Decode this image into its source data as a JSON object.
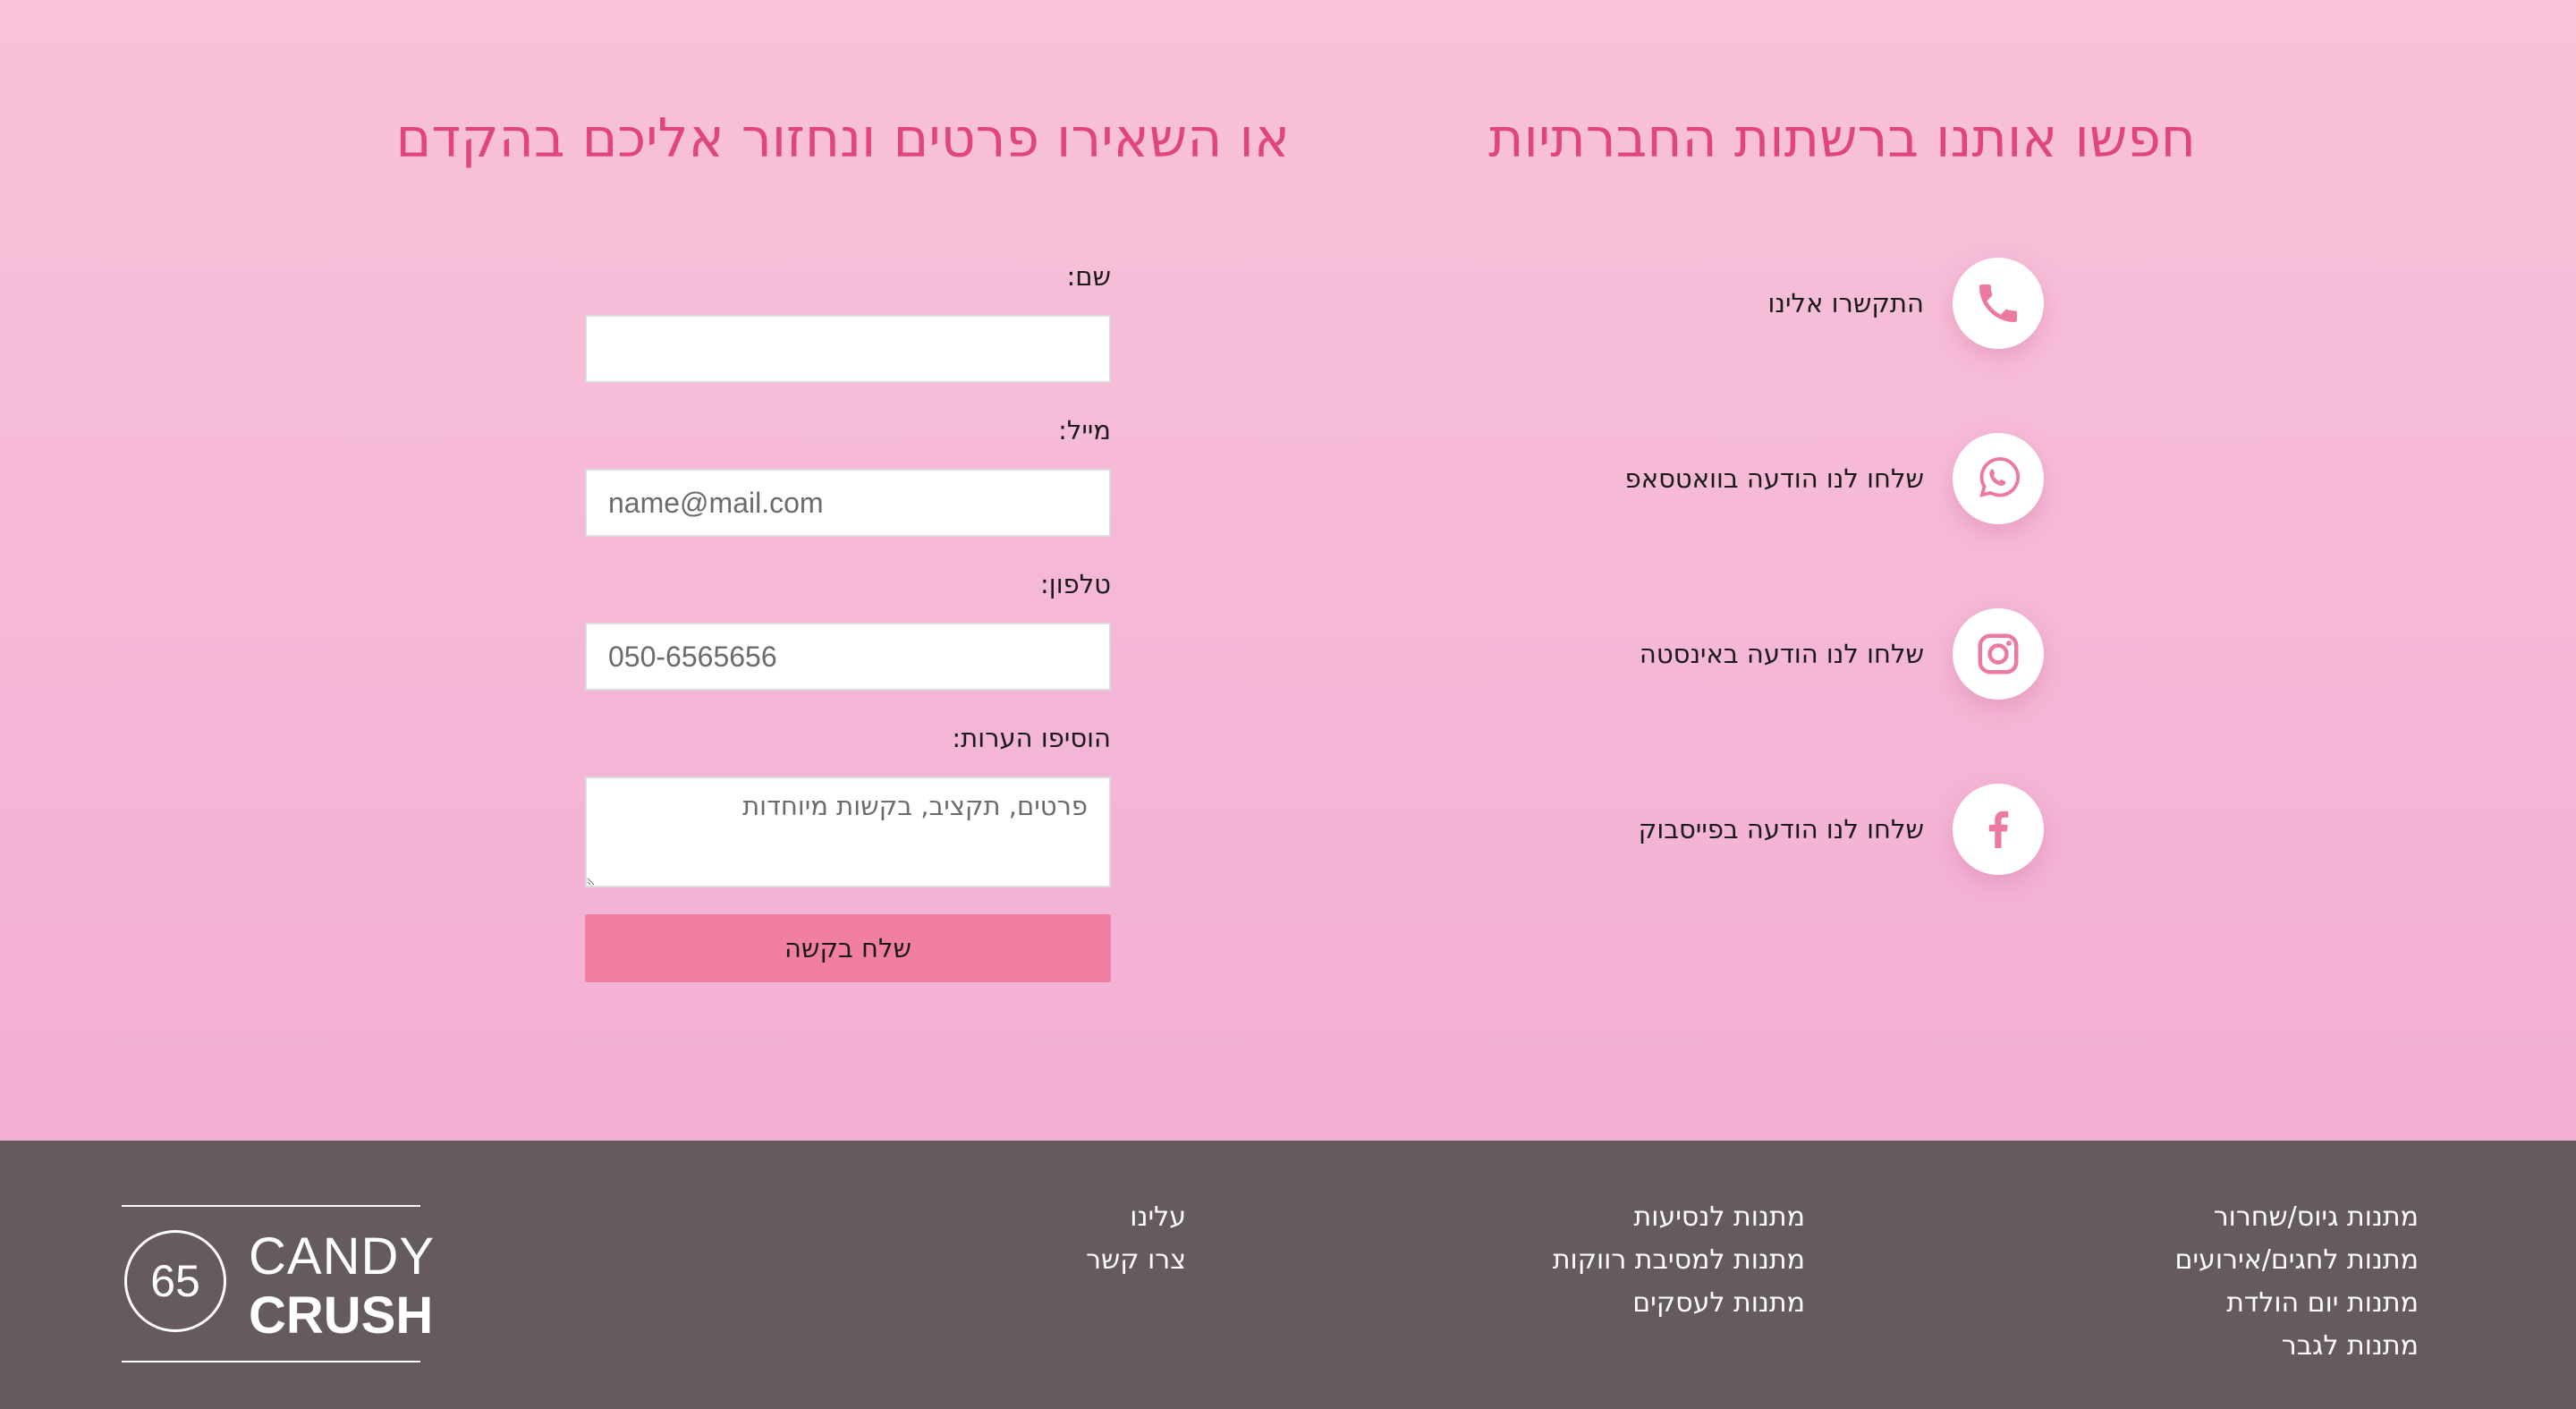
{
  "social_section": {
    "heading": "חפשו אותנו ברשתות החברתיות",
    "items": [
      {
        "label": "התקשרו אלינו",
        "icon": "phone-icon"
      },
      {
        "label": "שלחו לנו הודעה בוואטסאפ",
        "icon": "whatsapp-icon"
      },
      {
        "label": "שלחו לנו הודעה באינסטה",
        "icon": "instagram-icon"
      },
      {
        "label": "שלחו לנו הודעה בפייסבוק",
        "icon": "facebook-icon"
      }
    ]
  },
  "form_section": {
    "heading": "או השאירו פרטים ונחזור אליכם בהקדם",
    "name_label": "שם:",
    "name_placeholder": "",
    "email_label": "מייל:",
    "email_placeholder": "name@mail.com",
    "phone_label": "טלפון:",
    "phone_placeholder": "050-6565656",
    "notes_label": "הוסיפו הערות:",
    "notes_placeholder": "פרטים, תקציב, בקשות מיוחדות",
    "submit_label": "שלח בקשה"
  },
  "footer": {
    "col1": [
      "מתנות גיוס/שחרור",
      "מתנות לחגים/אירועים",
      "מתנות יום הולדת",
      "מתנות לגבר"
    ],
    "col2": [
      "מתנות לנסיעות",
      "מתנות למסיבת רווקות",
      "מתנות לעסקים"
    ],
    "col3": [
      "עלינו",
      "צרו קשר"
    ],
    "logo": {
      "badge": "65",
      "line1": "CANDY",
      "line2": "CRUSH"
    }
  },
  "colors": {
    "accent_heading": "#e0457b",
    "icon_pink": "#ec7aa0",
    "submit_bg": "#f07fa1",
    "footer_bg": "#655a5d"
  }
}
